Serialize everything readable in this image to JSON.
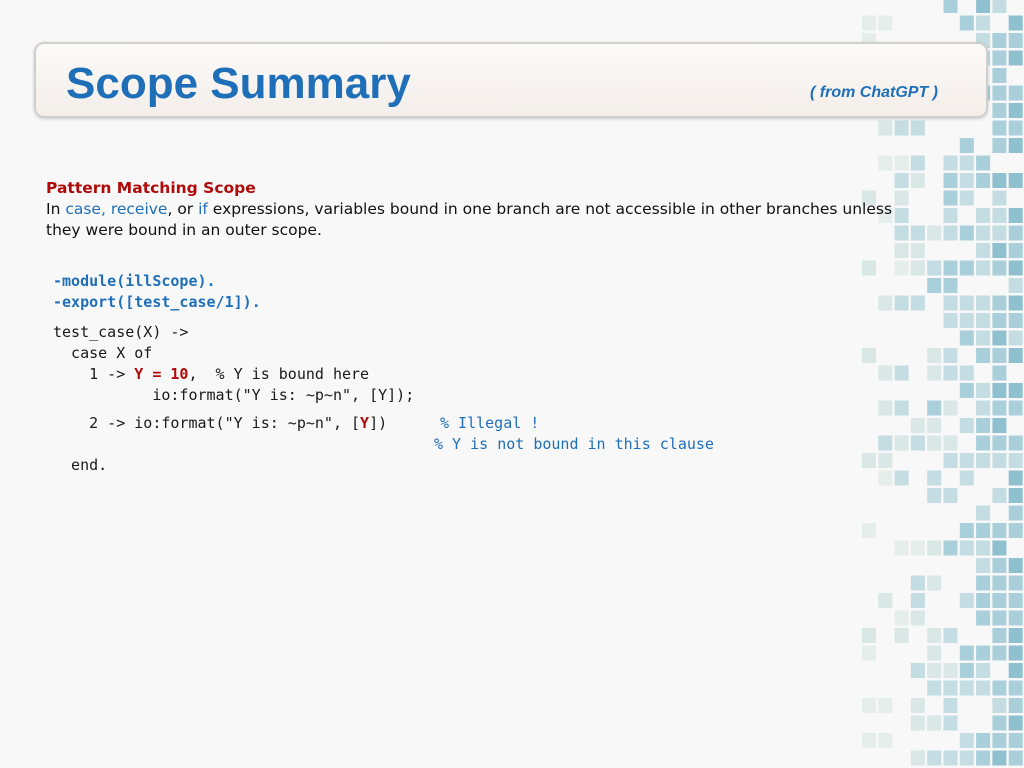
{
  "title": "Scope Summary",
  "subtitle": "( from ChatGPT )",
  "section": {
    "heading": "Pattern Matching Scope",
    "line1_prefix": "In ",
    "kw_case_receive": "case, receive",
    "line1_or": ", or ",
    "kw_if": "if",
    "line1_rest": " expressions, variables bound in one branch are not accessible in other branches unless",
    "line2": "they were bound in an outer scope."
  },
  "code": {
    "module_line": "-module(illScope).",
    "export_line": "-export([test_case/1]).",
    "func_head": "test_case(X) ->",
    "case_line": "  case X of",
    "branch1_prefix": "    1 -> ",
    "branch1_bind": "Y = 10",
    "branch1_suffix": ",  % Y is bound here",
    "format1": "           io:format(\"Y is: ~p~n\", [Y]);",
    "branch2_prefix": "    2 -> io:format(\"Y is: ~p~n\", [",
    "branch2_y": "Y",
    "branch2_suffix": "])",
    "branch2_comment": "% Illegal !",
    "branch2_comment2": "% Y is not bound in this clause",
    "end_line": "  end."
  },
  "colors": {
    "title_blue": "#1f6fb8",
    "heading_red": "#b00a0a",
    "mosaic_teal": "#8fc0cf"
  }
}
